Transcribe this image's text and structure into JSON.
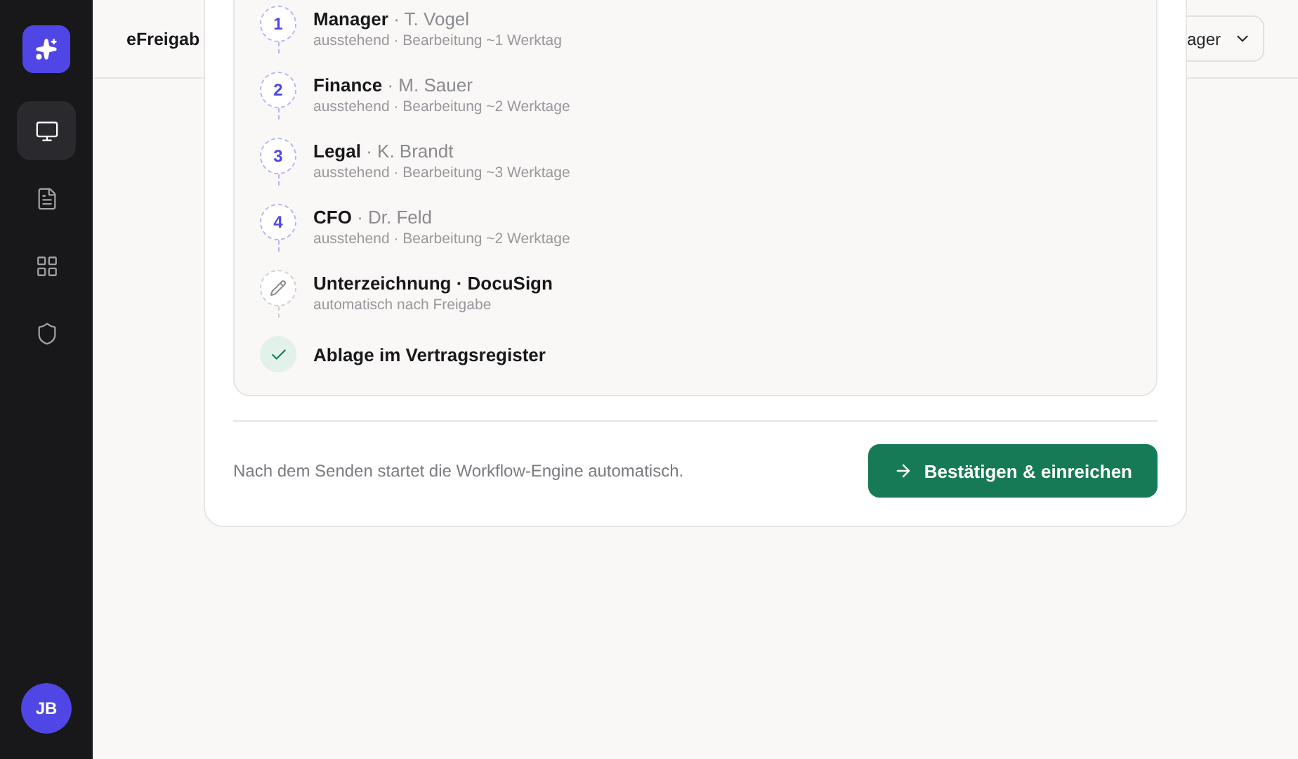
{
  "sidebar": {
    "items": [
      {
        "selected": true
      },
      {
        "selected": false
      },
      {
        "selected": false
      },
      {
        "selected": false
      }
    ],
    "avatar": "JB"
  },
  "header": {
    "title": "eFreigab",
    "role_button": "ager"
  },
  "steps": [
    {
      "kind": "pending",
      "number": "1",
      "title": "Manager",
      "assignee": "· T. Vogel",
      "detail": "ausstehend · Bearbeitung ~1 Werktag"
    },
    {
      "kind": "pending",
      "number": "2",
      "title": "Finance",
      "assignee": "· M. Sauer",
      "detail": "ausstehend · Bearbeitung ~2 Werktage"
    },
    {
      "kind": "pending",
      "number": "3",
      "title": "Legal",
      "assignee": "· K. Brandt",
      "detail": "ausstehend · Bearbeitung ~3 Werktage"
    },
    {
      "kind": "pending",
      "number": "4",
      "title": "CFO",
      "assignee": "· Dr. Feld",
      "detail": "ausstehend · Bearbeitung ~2 Werktage"
    },
    {
      "kind": "signature",
      "title": "Unterzeichnung · DocuSign",
      "detail": "automatisch nach Freigabe"
    },
    {
      "kind": "done",
      "title": "Ablage im Vertragsregister"
    }
  ],
  "footer": {
    "note": "Nach dem Senden startet die Workflow-Engine automatisch.",
    "submit": "Bestätigen & einreichen"
  }
}
